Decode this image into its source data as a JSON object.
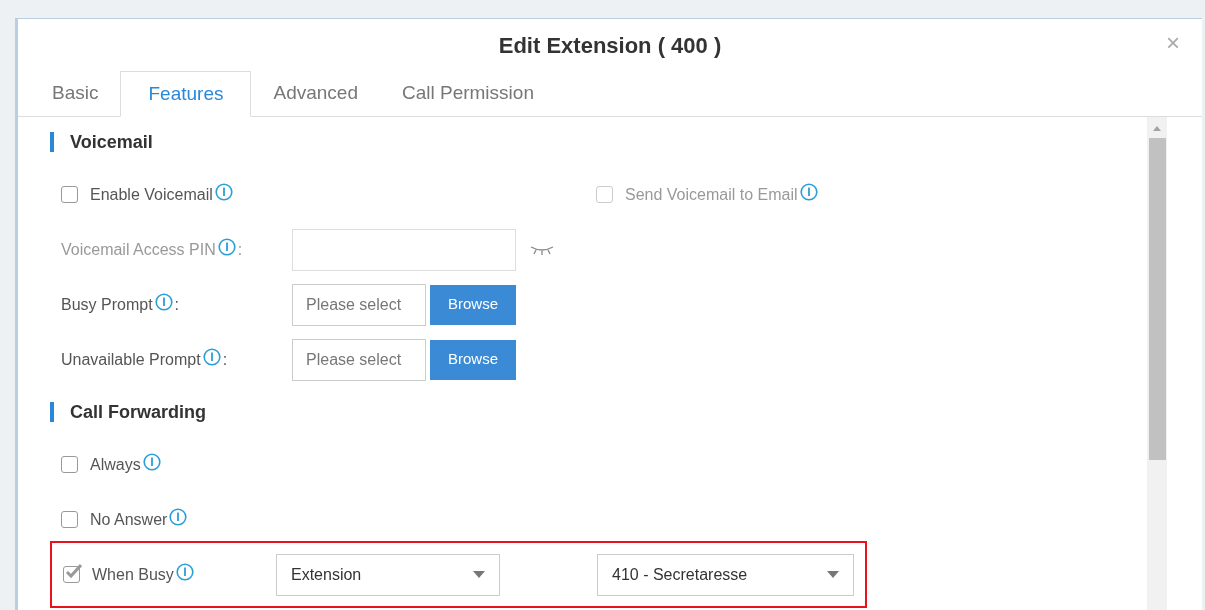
{
  "dialog": {
    "title": "Edit Extension ( 400 )",
    "close": "×"
  },
  "tabs": [
    {
      "label": "Basic",
      "selected": false
    },
    {
      "label": "Features",
      "selected": true
    },
    {
      "label": "Advanced",
      "selected": false
    },
    {
      "label": "Call Permission",
      "selected": false
    }
  ],
  "sections": [
    {
      "heading": "Voicemail",
      "rows": [
        {
          "kind": "checkpair",
          "items": [
            {
              "label": "Enable Voicemail",
              "checked": false,
              "disabled": false
            },
            {
              "label": "Send Voicemail to Email",
              "checked": false,
              "disabled": true
            }
          ]
        },
        {
          "kind": "password",
          "label": "Voicemail Access PIN",
          "colon": ":",
          "disabled": true
        },
        {
          "kind": "file",
          "label": "Busy Prompt",
          "colon": ":",
          "placeholder": "Please select",
          "button": "Browse"
        },
        {
          "kind": "file",
          "label": "Unavailable Prompt",
          "colon": ":",
          "placeholder": "Please select",
          "button": "Browse"
        }
      ]
    },
    {
      "heading": "Call Forwarding",
      "rows": [
        {
          "kind": "check",
          "label": "Always",
          "checked": false
        },
        {
          "kind": "check",
          "label": "No Answer",
          "checked": false
        },
        {
          "kind": "forward",
          "label": "When Busy",
          "checked": true,
          "highlighted": true,
          "type": "Extension",
          "target": "410 - Secretaresse"
        }
      ]
    }
  ]
}
